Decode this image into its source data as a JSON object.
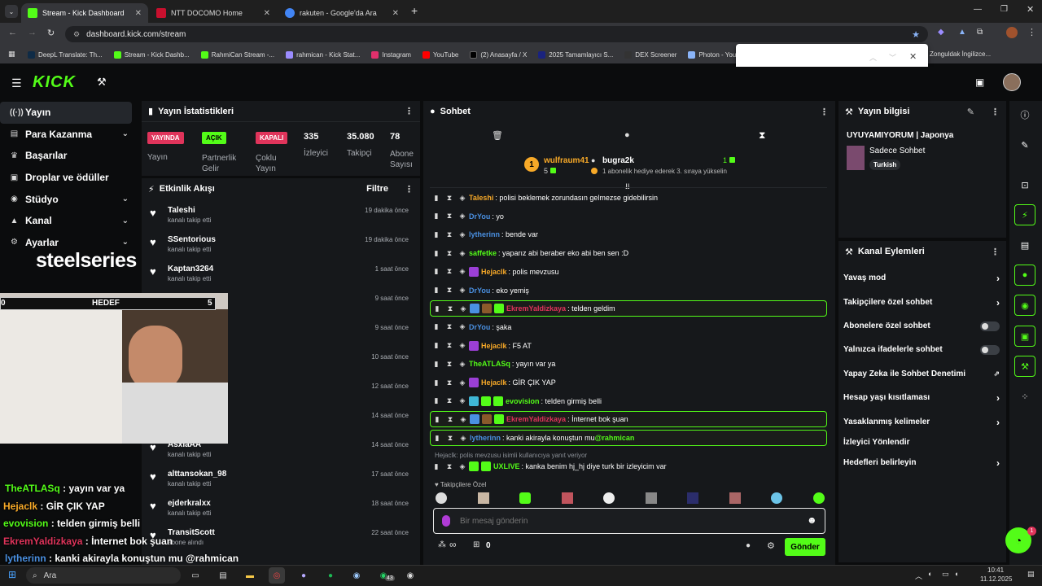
{
  "browser": {
    "tabs": [
      {
        "label": "Stream - Kick Dashboard",
        "color": "#53fc18"
      },
      {
        "label": "NTT DOCOMO Home",
        "color": "#c8102e"
      },
      {
        "label": "rakuten - Google'da Ara",
        "color": "#4285f4"
      }
    ],
    "url": "dashboard.kick.com/stream",
    "bookmarks": [
      "DeepL Translate: Th...",
      "Stream - Kick Dashb...",
      "RahmiCan Stream -...",
      "rahmican - Kick Stat...",
      "Instagram",
      "YouTube",
      "(2) Anasayfa / X",
      "2025 Tamamlayıcı S...",
      "DEX Screener",
      "Photon - Your Trust",
      "Zonguldak İngilizce..."
    ]
  },
  "nav": {
    "items": [
      {
        "label": "Yayın",
        "icon": "broadcast-icon"
      },
      {
        "label": "Para Kazanma",
        "icon": "money-icon"
      },
      {
        "label": "Başarılar",
        "icon": "trophy-icon"
      },
      {
        "label": "Droplar ve ödüller",
        "icon": "gift-icon"
      },
      {
        "label": "Stüdyo",
        "icon": "studio-icon"
      },
      {
        "label": "Kanal",
        "icon": "channel-icon"
      },
      {
        "label": "Ayarlar",
        "icon": "settings-icon"
      }
    ]
  },
  "stats": {
    "title": "Yayın İstatistikleri",
    "badges": [
      "YAYINDA",
      "AÇIK",
      "KAPALI"
    ],
    "labels": [
      "Yayın",
      "Partnerlik Gelir",
      "Çoklu Yayın",
      "İzleyici",
      "Takipçi",
      "Abone Sayısı"
    ],
    "viewers": "335",
    "followers": "35.080",
    "subs": "78"
  },
  "feed": {
    "title": "Etkinlik Akışı",
    "filter": "Filtre",
    "items": [
      {
        "name": "Taleshi",
        "sub": "kanalı takip etti",
        "time": "19 dakika önce"
      },
      {
        "name": "SSentorious",
        "sub": "kanalı takip etti",
        "time": "19 dakika önce"
      },
      {
        "name": "Kaptan3264",
        "sub": "kanalı takip etti",
        "time": "1 saat önce"
      },
      {
        "name": "LebelC4",
        "sub": "kanalı takip etti",
        "time": "9 saat önce"
      },
      {
        "name": "",
        "sub": "",
        "time": "9 saat önce"
      },
      {
        "name": "",
        "sub": "",
        "time": "10 saat önce"
      },
      {
        "name": "",
        "sub": "",
        "time": "12 saat önce"
      },
      {
        "name": "",
        "sub": "",
        "time": "14 saat önce"
      },
      {
        "name": "AsxiaAA",
        "sub": "kanalı takip etti",
        "time": "14 saat önce"
      },
      {
        "name": "alttansokan_98",
        "sub": "kanalı takip etti",
        "time": "17 saat önce"
      },
      {
        "name": "ejderkralxx",
        "sub": "kanalı takip etti",
        "time": "18 saat önce"
      },
      {
        "name": "TransitScott",
        "sub": "abone alındı",
        "time": "22 saat önce"
      }
    ]
  },
  "chat": {
    "title": "Sohbet",
    "leader1": {
      "name": "wulfraum41",
      "rank": "1",
      "count": "5"
    },
    "leader2": {
      "name": "bugra2k",
      "count": "1",
      "note": "1 abonelik hediye ederek 3. sıraya yükselin"
    },
    "messages": [
      {
        "user": "Taleshi",
        "color": "#f7a928",
        "text": ": polisi beklemek zorundasın gelmezse gidebilirsin",
        "hl": false
      },
      {
        "user": "DrYou",
        "color": "#4a90e2",
        "text": ": yo",
        "hl": false
      },
      {
        "user": "lytherinn",
        "color": "#4a90e2",
        "text": ": bende var",
        "hl": false
      },
      {
        "user": "saffetke",
        "color": "#53fc18",
        "text": ": yaparız abi beraber eko abi ben sen :D",
        "hl": false
      },
      {
        "user": "Hejaclk",
        "color": "#f7a928",
        "text": ": polis mevzusu",
        "hl": false
      },
      {
        "user": "DrYou",
        "color": "#4a90e2",
        "text": ": eko yemiş",
        "hl": false
      },
      {
        "user": "EkremYaldizkaya",
        "color": "#e0345b",
        "text": ": telden geldim",
        "hl": true
      },
      {
        "user": "DrYou",
        "color": "#4a90e2",
        "text": ": şaka",
        "hl": false
      },
      {
        "user": "Hejaclk",
        "color": "#f7a928",
        "text": ": F5 AT",
        "hl": false
      },
      {
        "user": "TheATLASq",
        "color": "#53fc18",
        "text": ": yayın var ya",
        "hl": false
      },
      {
        "user": "Hejaclk",
        "color": "#f7a928",
        "text": ": GİR ÇIK YAP",
        "hl": false
      },
      {
        "user": "evovision",
        "color": "#53fc18",
        "text": ": telden girmiş belli",
        "hl": false
      },
      {
        "user": "EkremYaldizkaya",
        "color": "#e0345b",
        "text": ": İnternet bok şuan",
        "hl": true
      },
      {
        "user": "lytherinn",
        "color": "#4a90e2",
        "text": ": kanki akirayla konuştun mu ",
        "mention": "@rahmican",
        "hl": true
      }
    ],
    "reply_note": "Hejaclk: polis mevzusu isimli kullanıcıya yanıt veriyor",
    "last": {
      "user": "UXLIVE",
      "color": "#53fc18",
      "text": ": kanka benim hj_hj diye turk bir izleyicim var"
    },
    "followers_only": "Takipçilere Özel",
    "placeholder": "Bir mesaj gönderin",
    "send": "Gönder",
    "infinity": "∞",
    "gift_count": "0"
  },
  "info": {
    "title": "Yayın bilgisi",
    "stream_title": "UYUYAMIYORUM | Japonya",
    "category": "Sadece Sohbet",
    "tag": "Turkish"
  },
  "actions": {
    "title": "Kanal Eylemleri",
    "items": [
      "Yavaş mod",
      "Takipçilere özel sohbet",
      "Abonelere özel sohbet",
      "Yalnızca ifadelerle sohbet",
      "Yapay Zeka ile Sohbet Denetimi",
      "Hesap yaşı kısıtlaması",
      "Yasaklanmış kelimeler",
      "İzleyici Yönlendir",
      "Hedefleri belirleyin"
    ]
  },
  "overlay": {
    "brand": "steelseries",
    "goal": "HEDEF",
    "goal_left": "0",
    "goal_right": "5",
    "chat": [
      {
        "user": "TheATLASq",
        "color": "#53fc18",
        "text": " : yayın var ya"
      },
      {
        "user": "Hejaclk",
        "color": "#f7a928",
        "text": " : GİR ÇIK YAP"
      },
      {
        "user": "evovision",
        "color": "#53fc18",
        "text": " : telden girmiş belli"
      },
      {
        "user": "EkremYaldizkaya",
        "color": "#e0345b",
        "text": " : İnternet bok şuan"
      },
      {
        "user": "lytherinn",
        "color": "#4a90e2",
        "text": " : kanki akirayla konuştun mu @rahmican"
      }
    ]
  },
  "taskbar": {
    "search": "Ara",
    "time": "10:41",
    "date": "11.12.2025",
    "whatsapp_count": "43",
    "notif": "1"
  }
}
